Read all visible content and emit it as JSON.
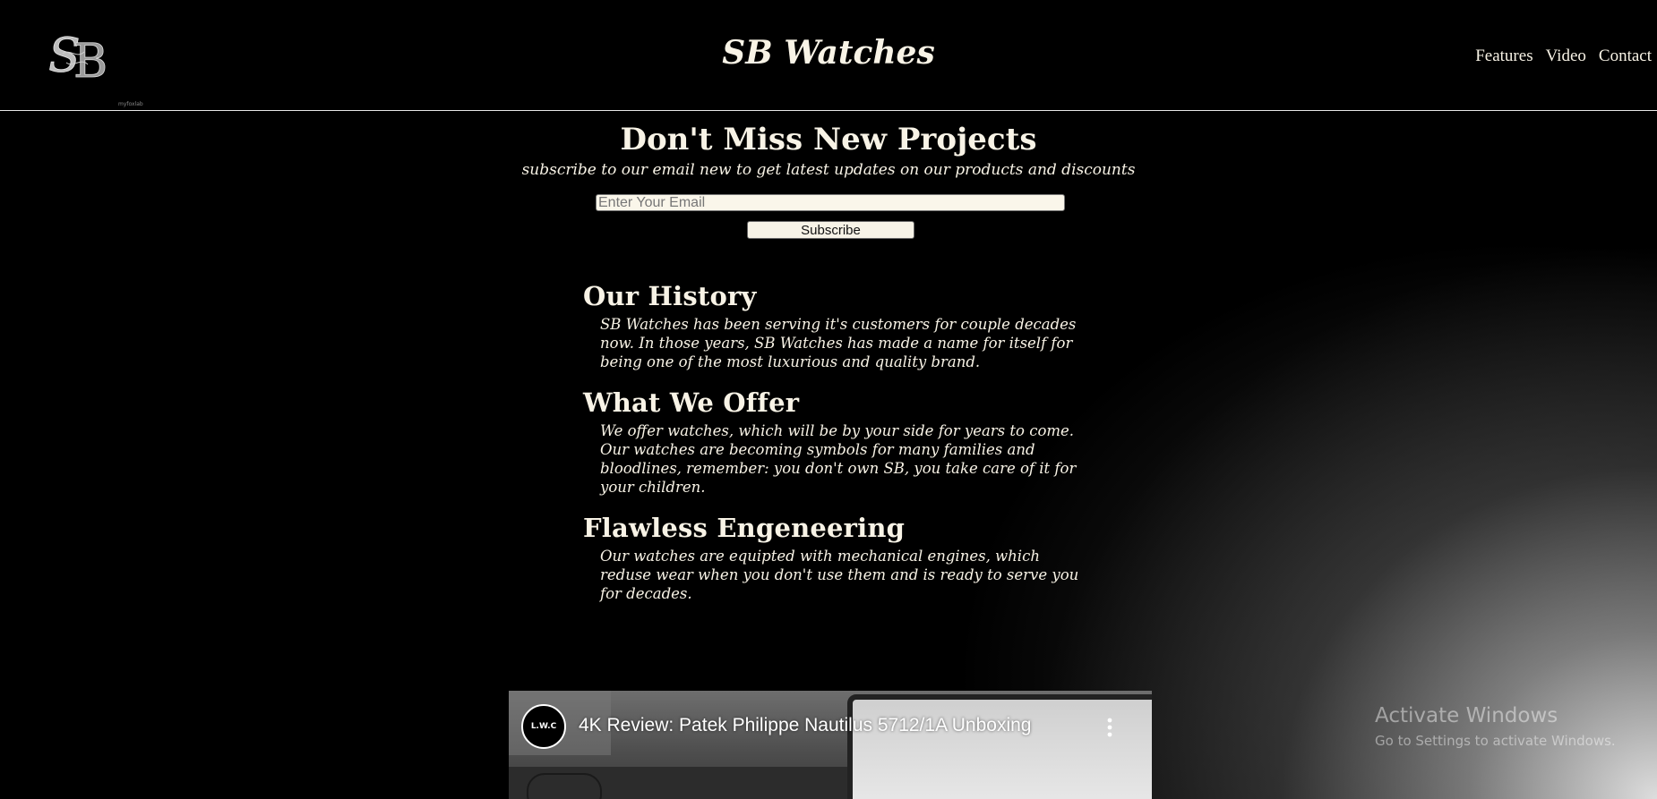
{
  "header": {
    "logo_text": "SB",
    "logo_caption": "myfoxlab",
    "title": "SB Watches",
    "nav": [
      {
        "label": "Features"
      },
      {
        "label": "Video"
      },
      {
        "label": "Contact"
      }
    ]
  },
  "subscribe": {
    "heading": "Don't Miss New Projects",
    "subtitle": "subscribe to our email new to get latest updates on our products and discounts",
    "email_placeholder": "Enter Your Email",
    "button_label": "Subscribe"
  },
  "features": [
    {
      "heading": "Our History",
      "body": "SB Watches has been serving it's customers for couple decades now. In those years, SB Watches has made a name for itself for being one of the most luxurious and quality brand."
    },
    {
      "heading": "What We Offer",
      "body": "We offer watches, which will be by your side for years to come. Our watches are becoming symbols for many families and bloodlines, remember: you don't own SB, you take care of it for your children."
    },
    {
      "heading": "Flawless Engeneering",
      "body": "Our watches are equipted with mechanical engines, which reduse wear when you don't use them and is ready to serve you for decades."
    }
  ],
  "video": {
    "channel_initials": "L.W.C",
    "title": "4K Review: Patek Philippe Nautilus 5712/1A Unboxing"
  },
  "watermark": {
    "title": "Activate Windows",
    "subtitle": "Go to Settings to activate Windows."
  },
  "colors": {
    "background": "#000000",
    "text": "#f8f3e6",
    "input_bg": "#faf6ea"
  }
}
